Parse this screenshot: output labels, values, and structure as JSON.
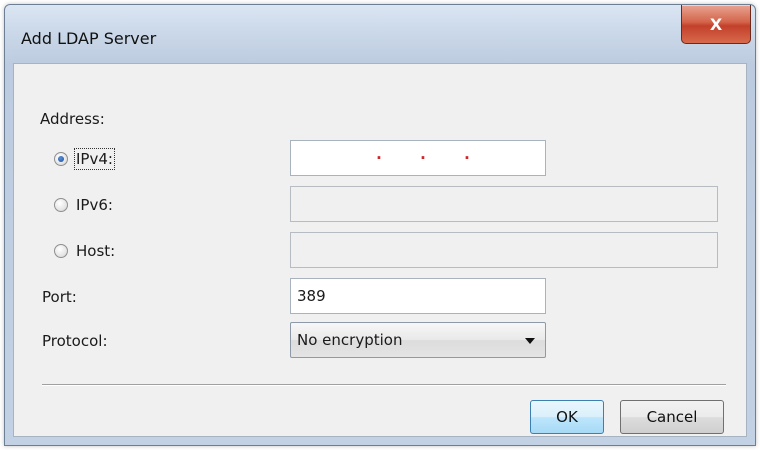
{
  "window": {
    "title": "Add LDAP Server",
    "close_glyph": "X"
  },
  "form": {
    "address_label": "Address:",
    "ipv4_label": "IPv4:",
    "ipv6_label": "IPv6:",
    "host_label": "Host:",
    "selected_address_type": "IPv4",
    "ipv4_value": ". . .",
    "ipv6_value": "",
    "host_value": "",
    "port_label": "Port:",
    "port_value": "389",
    "protocol_label": "Protocol:",
    "protocol_value": "No encryption"
  },
  "buttons": {
    "ok_label": "OK",
    "cancel_label": "Cancel"
  },
  "icons": {
    "close": "close-icon",
    "dropdown": "chevron-down-icon",
    "radio": "radio-button"
  }
}
